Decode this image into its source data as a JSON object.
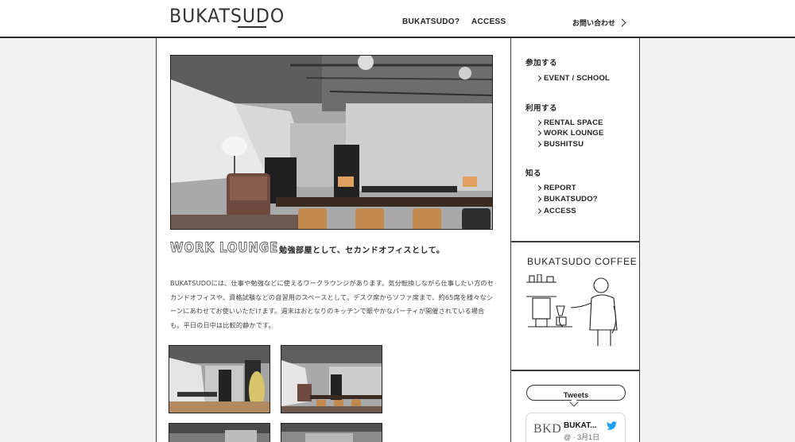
{
  "header": {
    "logo": "BUKATSUDO",
    "nav": [
      {
        "label": "BUKATSUDO?"
      },
      {
        "label": "ACCESS"
      }
    ],
    "contact_label": "お問い合わせ"
  },
  "main": {
    "section_title": "WORK LOUNGE",
    "tagline": "勉強部屋として、セカンドオフィスとして。",
    "description": "BUKATSUDOには、仕事や勉強などに使えるワークラウンジがあります。気分転換しながら仕事したい方のセカンドオフィスや、資格試験などの自習用のスペースとして。デスク席からソファ席まで、約65席を様々なシーンにあわせてお使いいただけます。週末はおとなりのキッチンで賑やかなパーティが開催されている場合も。平日の日中は比較的静かです。"
  },
  "sidebar": {
    "groups": [
      {
        "heading": "参加する",
        "items": [
          "EVENT / SCHOOL"
        ]
      },
      {
        "heading": "利用する",
        "items": [
          "RENTAL SPACE",
          "WORK LOUNGE",
          "BUSHITSU"
        ]
      },
      {
        "heading": "知る",
        "items": [
          "REPORT",
          "BUKATSUDO?",
          "ACCESS"
        ]
      }
    ],
    "coffee_title": "BUKATSUDO COFFEE",
    "tweets_label": "Tweets",
    "tweet": {
      "avatar_text": "BKD",
      "name": "BUKAT...",
      "meta": "@ · 3月1日"
    }
  },
  "colors": {
    "background": "#f1f1f1",
    "panel": "#ffffff",
    "border": "#2a2a2a",
    "twitter": "#1da1f2"
  }
}
